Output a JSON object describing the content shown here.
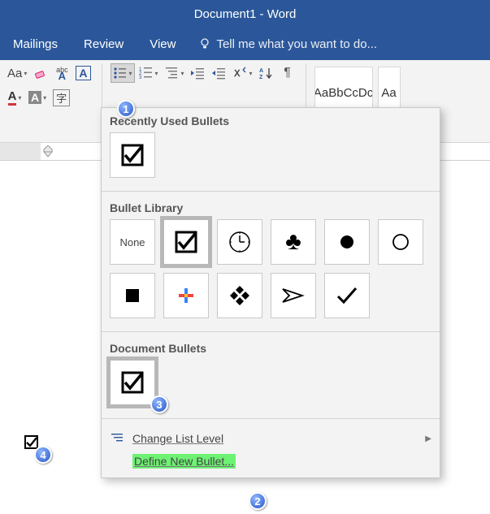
{
  "title": "Document1 - Word",
  "tabs": {
    "mailings": "Mailings",
    "review": "Review",
    "view": "View",
    "tellme": "Tell me what you want to do..."
  },
  "styles": {
    "item1": "AaBbCcDc",
    "item2": "Aa"
  },
  "dropdown": {
    "recent_title": "Recently Used Bullets",
    "library_title": "Bullet Library",
    "document_title": "Document Bullets",
    "none": "None",
    "change_level": "Change List Level",
    "define_new": "Define New Bullet..."
  },
  "annotations": {
    "a1": "1",
    "a2": "2",
    "a3": "3",
    "a4": "4"
  }
}
